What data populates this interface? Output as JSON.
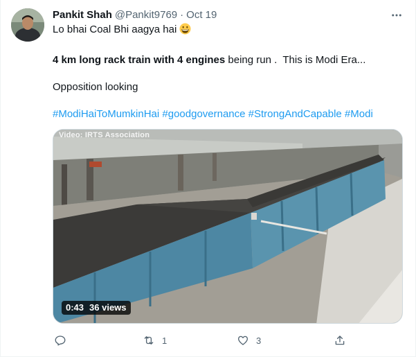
{
  "tweet": {
    "author_name": "Pankit Shah",
    "handle": "@Pankit9769",
    "separator": "·",
    "timestamp": "Oct 19",
    "line1": "Lo bhai Coal Bhi aagya hai",
    "line1_emoji": "grinning-face-emoji",
    "line2_bold": "4 km long rack train with 4 engines",
    "line2_rest": " being run .  This is Modi Era...",
    "line3": "Opposition looking",
    "hashtags": "#ModiHaiToMumkinHai #goodgovernance #StrongAndCapable #Modi"
  },
  "media": {
    "watermark": "Video: IRTS Association",
    "duration": "0:43",
    "views": "36 views"
  },
  "actions": {
    "reply_count": "",
    "retweet_count": "1",
    "like_count": "3"
  },
  "icons": {
    "more": "more-horizontal-icon",
    "reply": "reply-icon",
    "retweet": "retweet-icon",
    "like": "heart-icon",
    "share": "share-icon"
  },
  "colors": {
    "text": "#0f1419",
    "secondary": "#536471",
    "link": "#1d9bf0",
    "border": "#cfd9de"
  }
}
